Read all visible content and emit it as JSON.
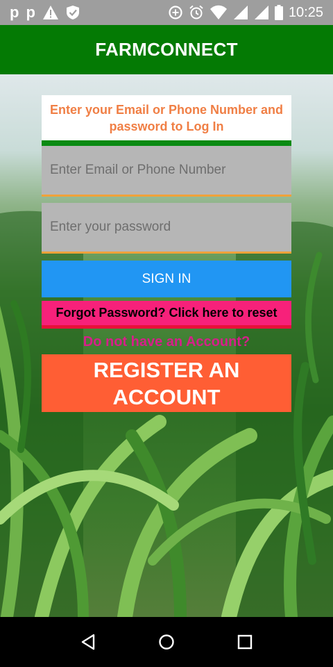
{
  "status_bar": {
    "left_icons": [
      "p",
      "p"
    ],
    "time": "10:25"
  },
  "app_bar": {
    "title": "FARMCONNECT"
  },
  "login": {
    "instructions": "Enter your Email or Phone Number and password to Log In",
    "email_placeholder": "Enter Email or Phone Number",
    "password_placeholder": "Enter your password",
    "sign_in_label": "SIGN IN",
    "forgot_label": "Forgot Password? Click here to reset",
    "no_account_text": "Do not have an Account?",
    "register_label": "REGISTER AN ACCOUNT"
  },
  "colors": {
    "app_bar": "#047a04",
    "sign_in": "#2196f3",
    "forgot": "#f7217a",
    "register": "#ff5e34",
    "instructions_text": "#f07f45"
  },
  "icons": {
    "status_left": [
      "parking-icon",
      "parking-icon",
      "warning-icon",
      "shield-icon"
    ],
    "status_right": [
      "data-saver-icon",
      "alarm-icon",
      "wifi-icon",
      "signal-icon",
      "signal-icon",
      "battery-icon"
    ],
    "nav": [
      "back-icon",
      "home-icon",
      "recents-icon"
    ]
  }
}
